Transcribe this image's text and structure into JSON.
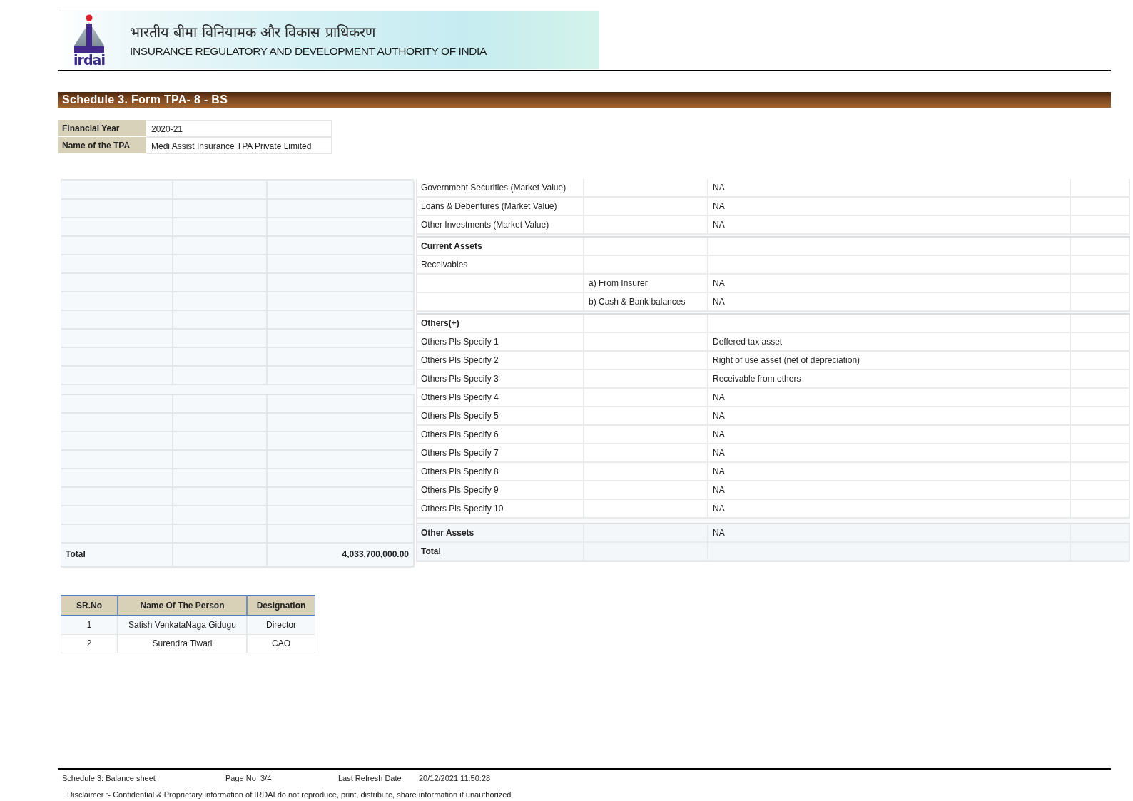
{
  "header": {
    "logo_wordmark": "irdai",
    "title_hindi": "भारतीय बीमा विनियामक और विकास प्राधिकरण",
    "title_english": "INSURANCE REGULATORY AND DEVELOPMENT AUTHORITY OF INDIA"
  },
  "form_title": "Schedule 3. Form TPA- 8 - BS",
  "details": [
    {
      "label": "Financial Year",
      "value": "2020-21"
    },
    {
      "label": "Name of the TPA",
      "value": "Medi Assist Insurance TPA Private Limited"
    }
  ],
  "left_table": {
    "rows": [
      {
        "kind": "blank"
      },
      {
        "kind": "blank"
      },
      {
        "kind": "blank"
      },
      {
        "kind": "blank"
      },
      {
        "kind": "blank"
      },
      {
        "kind": "blank"
      },
      {
        "kind": "blank"
      },
      {
        "kind": "blank"
      },
      {
        "kind": "blank"
      },
      {
        "kind": "blank"
      },
      {
        "kind": "blank"
      },
      {
        "kind": "spacer"
      },
      {
        "kind": "blank"
      },
      {
        "kind": "blank"
      },
      {
        "kind": "blank"
      },
      {
        "kind": "blank"
      },
      {
        "kind": "blank"
      },
      {
        "kind": "blank"
      },
      {
        "kind": "blank"
      },
      {
        "kind": "blank"
      }
    ],
    "total": {
      "label": "Total",
      "amount": "4,033,700,000.00"
    }
  },
  "right_table": {
    "rows": [
      {
        "kind": "item",
        "label": "Government Securities (Market Value)",
        "value": "NA"
      },
      {
        "kind": "item",
        "label": "Loans & Debentures (Market Value)",
        "value": "NA"
      },
      {
        "kind": "item",
        "label": "Other Investments (Market Value)",
        "value": "NA"
      },
      {
        "kind": "spacer"
      },
      {
        "kind": "heading",
        "label": "Current Assets"
      },
      {
        "kind": "item",
        "label": "Receivables"
      },
      {
        "kind": "item",
        "sub_label": "a) From Insurer",
        "value": "NA"
      },
      {
        "kind": "item",
        "sub_label": "b) Cash & Bank balances",
        "value": "NA"
      },
      {
        "kind": "spacer"
      },
      {
        "kind": "heading",
        "label": "Others(+)"
      },
      {
        "kind": "item",
        "label": "Others Pls Specify 1",
        "value": "Deffered tax asset"
      },
      {
        "kind": "item",
        "label": "Others Pls Specify 2",
        "value": "Right of use asset (net of depreciation)"
      },
      {
        "kind": "item",
        "label": "Others Pls Specify 3",
        "value": "Receivable from others"
      },
      {
        "kind": "item",
        "label": "Others Pls Specify 4",
        "value": "NA"
      },
      {
        "kind": "item",
        "label": "Others Pls Specify 5",
        "value": "NA"
      },
      {
        "kind": "item",
        "label": "Others Pls Specify 6",
        "value": "NA"
      },
      {
        "kind": "item",
        "label": "Others Pls Specify 7",
        "value": "NA"
      },
      {
        "kind": "item",
        "label": "Others Pls Specify 8",
        "value": "NA"
      },
      {
        "kind": "item",
        "label": "Others Pls Specify 9",
        "value": "NA"
      },
      {
        "kind": "item",
        "label": "Others Pls Specify 10",
        "value": "NA"
      },
      {
        "kind": "spacer"
      },
      {
        "kind": "summary",
        "label": "Other Assets",
        "value": "NA"
      },
      {
        "kind": "summary",
        "label": "Total"
      }
    ]
  },
  "signatories": {
    "columns": [
      "SR.No",
      "Name Of The Person",
      "Designation"
    ],
    "rows": [
      {
        "sr_no": "1",
        "name": "Satish VenkataNaga Gidugu",
        "designation": "Director"
      },
      {
        "sr_no": "2",
        "name": "Surendra Tiwari",
        "designation": "CAO"
      }
    ]
  },
  "footer": {
    "report_name": "Schedule 3: Balance sheet",
    "page_label": "Page No",
    "page": "3/4",
    "refresh_label": "Last Refresh Date",
    "refresh_date": "20/12/2021 11:50:28",
    "disclaimer": "Disclaimer :- Confidential & Proprietary information of IRDAI do not reproduce, print, distribute, share information if unauthorized"
  }
}
